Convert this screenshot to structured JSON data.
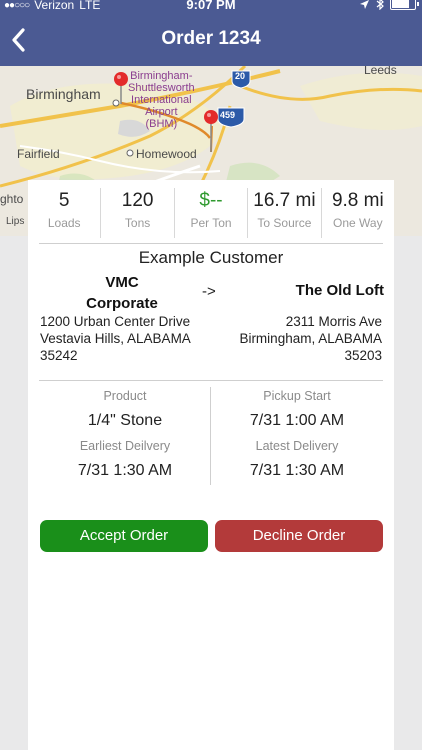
{
  "status_bar": {
    "carrier": "Verizon",
    "network": "LTE",
    "time": "9:07 PM"
  },
  "nav": {
    "title": "Order 1234"
  },
  "map": {
    "labels": {
      "birmingham": "Birmingham",
      "airport": "Birmingham-\nShuttlesworth\nInternational\nAirport\n(BHM)",
      "homewood": "Homewood",
      "fairfield": "Fairfield",
      "leeds": "Leeds",
      "highway_20": "20",
      "highway_459": "459",
      "edge_1": "ghto",
      "edge_2": "Lips"
    }
  },
  "stats": [
    {
      "value": "5",
      "label": "Loads"
    },
    {
      "value": "120",
      "label": "Tons"
    },
    {
      "value": "$--",
      "label": "Per Ton"
    },
    {
      "value": "16.7 mi",
      "label": "To Source"
    },
    {
      "value": "9.8 mi",
      "label": "One Way"
    }
  ],
  "order": {
    "customer": "Example Customer",
    "from_name": "VMC\nCorporate",
    "arrow": "->",
    "to_name": "The Old Loft",
    "from_address": "1200 Urban Center Drive\nVestavia Hills, ALABAMA\n35242",
    "to_address": "2311 Morris Ave\nBirmingham, ALABAMA\n35203"
  },
  "details": {
    "product_label": "Product",
    "product_value": "1/4\" Stone",
    "earliest_label": "Earliest Deilvery",
    "earliest_value": "7/31 1:30 AM",
    "pickup_label": "Pickup Start",
    "pickup_value": "7/31 1:00 AM",
    "latest_label": "Latest Delivery",
    "latest_value": "7/31 1:30 AM"
  },
  "buttons": {
    "accept": "Accept Order",
    "decline": "Decline Order"
  },
  "colors": {
    "nav_bar": "#4b5a93",
    "accept": "#1a8f1a",
    "decline": "#b33a3a",
    "price": "#2f9a2f"
  }
}
